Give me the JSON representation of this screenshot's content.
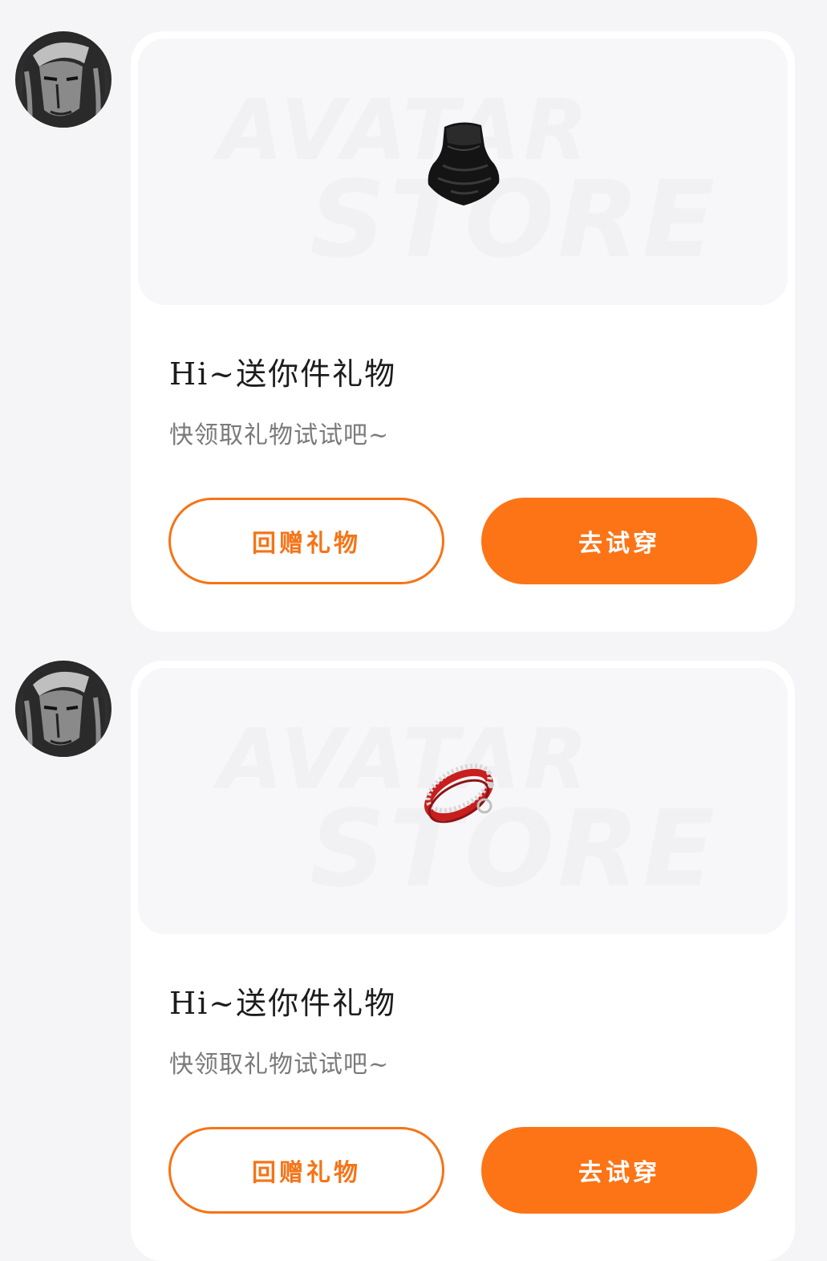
{
  "watermark": {
    "line1": "AVATAR",
    "line2": "STORE"
  },
  "colors": {
    "accent": "#fc7416",
    "accent_border": "#f57417",
    "page_bg": "#f5f5f7",
    "card_bg": "#ffffff"
  },
  "messages": [
    {
      "avatar_icon": "user-avatar",
      "gift_icon": "black-face-mask-icon",
      "title": "Hi~送你件礼物",
      "subtitle": "快领取礼物试试吧~",
      "return_gift_label": "回赠礼物",
      "try_on_label": "去试穿"
    },
    {
      "avatar_icon": "user-avatar",
      "gift_icon": "red-studded-bracelet-icon",
      "title": "Hi~送你件礼物",
      "subtitle": "快领取礼物试试吧~",
      "return_gift_label": "回赠礼物",
      "try_on_label": "去试穿"
    }
  ]
}
